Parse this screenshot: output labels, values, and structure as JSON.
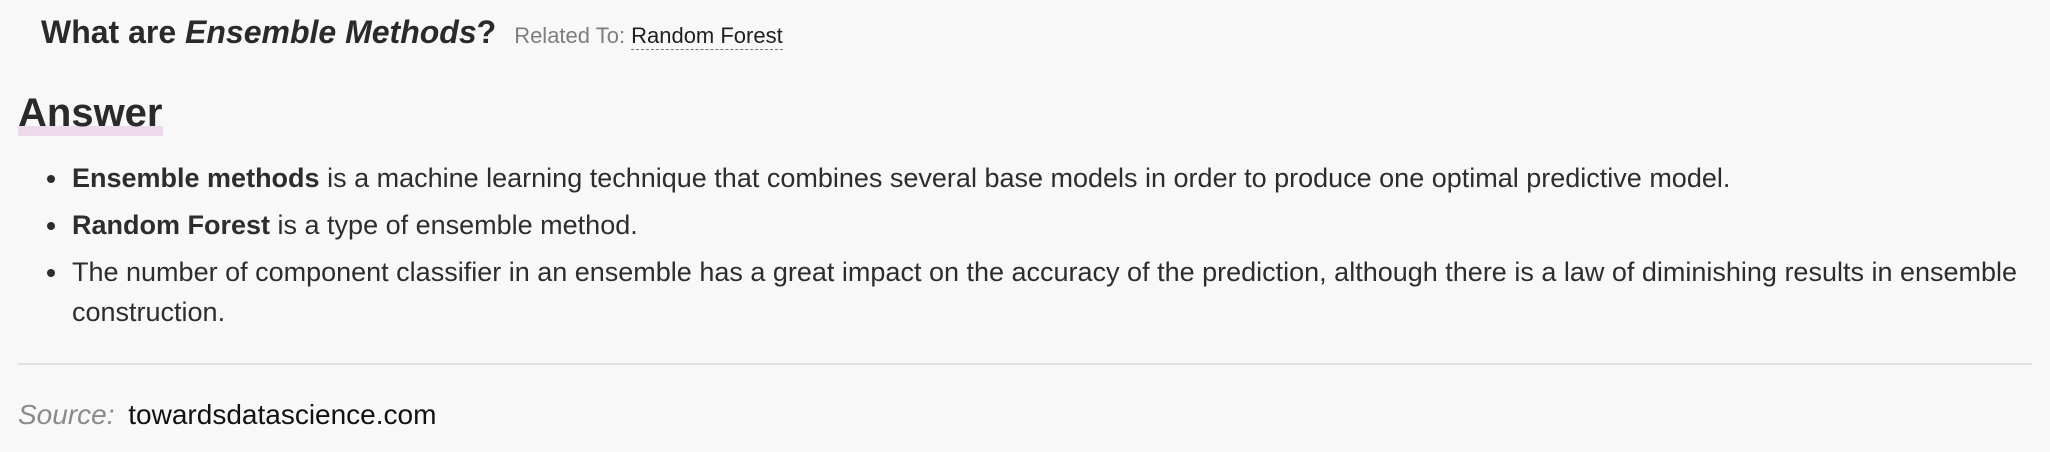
{
  "question": {
    "prefix": "What are ",
    "term": "Ensemble Methods",
    "suffix": "?"
  },
  "related": {
    "label": "Related To:",
    "link_text": "Random Forest"
  },
  "answer": {
    "heading": "Answer",
    "bullets": [
      {
        "bold": "Ensemble methods",
        "text": " is a machine learning technique that combines several base models in order to produce one optimal predictive model."
      },
      {
        "bold": "Random Forest",
        "text": " is a type of ensemble method."
      },
      {
        "bold": "",
        "text": "The number of component classifier in an ensemble has a great impact on the accuracy of the prediction, although there is a law of diminishing results in ensemble construction."
      }
    ]
  },
  "source": {
    "label": "Source:",
    "link_text": "towardsdatascience.com"
  }
}
